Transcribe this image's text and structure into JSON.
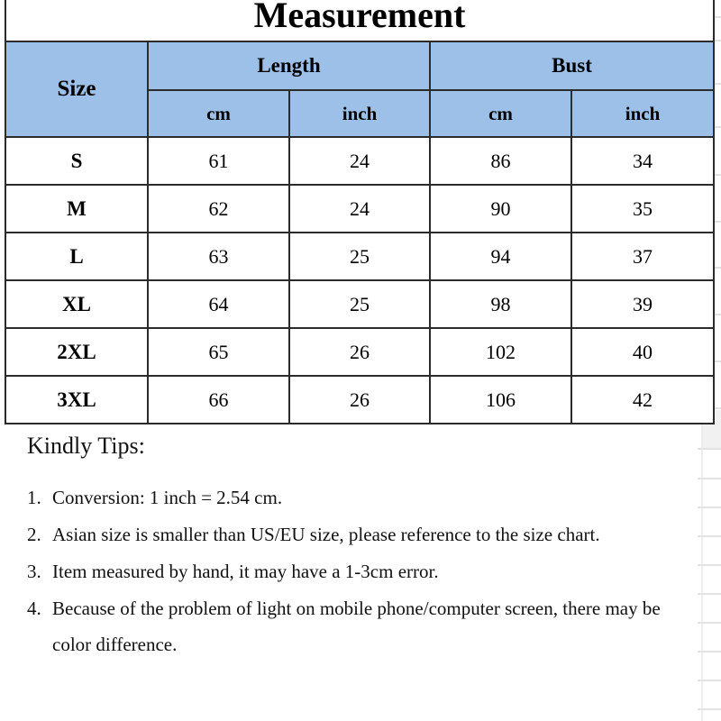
{
  "document": {
    "title": "Measurement",
    "type": "size-chart"
  },
  "table": {
    "size_header": "Size",
    "groups": [
      {
        "label": "Length",
        "units": [
          "cm",
          "inch"
        ]
      },
      {
        "label": "Bust",
        "units": [
          "cm",
          "inch"
        ]
      }
    ],
    "columns": [
      "Size",
      "Length cm",
      "Length inch",
      "Bust cm",
      "Bust inch"
    ],
    "rows": [
      {
        "size": "S",
        "length_cm": "61",
        "length_inch": "24",
        "bust_cm": "86",
        "bust_inch": "34"
      },
      {
        "size": "M",
        "length_cm": "62",
        "length_inch": "24",
        "bust_cm": "90",
        "bust_inch": "35"
      },
      {
        "size": "L",
        "length_cm": "63",
        "length_inch": "25",
        "bust_cm": "94",
        "bust_inch": "37"
      },
      {
        "size": "XL",
        "length_cm": "64",
        "length_inch": "25",
        "bust_cm": "98",
        "bust_inch": "39"
      },
      {
        "size": "2XL",
        "length_cm": "65",
        "length_inch": "26",
        "bust_cm": "102",
        "bust_inch": "40"
      },
      {
        "size": "3XL",
        "length_cm": "66",
        "length_inch": "26",
        "bust_cm": "106",
        "bust_inch": "42"
      }
    ]
  },
  "tips": {
    "heading": "Kindly Tips:",
    "items": [
      {
        "number": "1.",
        "text": "Conversion: 1 inch = 2.54 cm."
      },
      {
        "number": "2.",
        "text": "Asian size is smaller than US/EU size, please reference to the size chart."
      },
      {
        "number": "3.",
        "text": "Item measured by hand, it may have a 1-3cm error."
      },
      {
        "number": "4.",
        "text": "Because of the problem of light on mobile phone/computer screen, there may be color difference."
      }
    ]
  },
  "colors": {
    "header_blue": "#9cc0e7",
    "border": "#2b2b2b",
    "text": "#000000",
    "background": "#ffffff",
    "gridline_gray": "#e2e2e2"
  }
}
